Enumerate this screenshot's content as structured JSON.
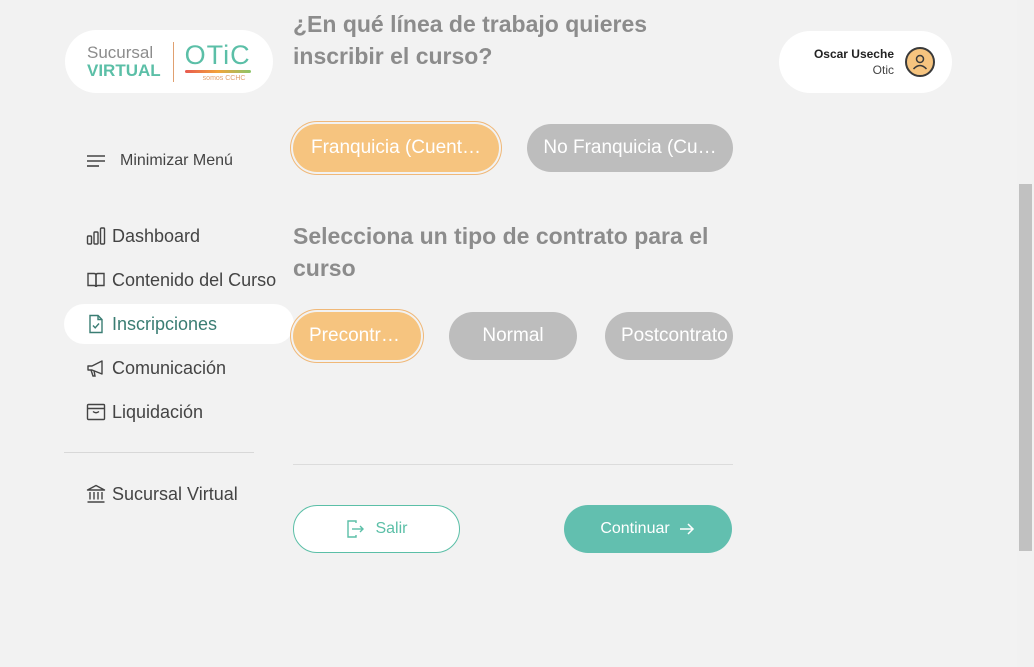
{
  "logo": {
    "line1": "Sucursal",
    "line2": "VIRTUAL",
    "brand": "OTiC",
    "brand_sub": "somos CCHC"
  },
  "sidebar": {
    "toggle_label": "Minimizar Menú",
    "items": [
      {
        "label": "Dashboard",
        "icon": "bar-chart-icon"
      },
      {
        "label": "Contenido del Curso",
        "icon": "book-icon"
      },
      {
        "label": "Inscripciones",
        "icon": "file-check-icon",
        "active": true
      },
      {
        "label": "Comunicación",
        "icon": "megaphone-icon"
      },
      {
        "label": "Liquidación",
        "icon": "archive-icon"
      }
    ],
    "footer_item": {
      "label": "Sucursal Virtual",
      "icon": "bank-icon"
    }
  },
  "main": {
    "question1": "¿En qué línea de trabajo quieres inscribir el curso?",
    "line_options": [
      "Franquicia (Cuent…",
      "No Franquicia (Cu…"
    ],
    "line_selected": "Franquicia (Cuent…",
    "question2": "Selecciona un tipo de contrato para el curso",
    "contract_options": [
      "Precontrato",
      "Normal",
      "Postcontrato"
    ],
    "contract_selected": "Precontrato",
    "exit_label": "Salir",
    "continue_label": "Continuar"
  },
  "user": {
    "name": "Oscar Useche",
    "org": "Otic"
  },
  "colors": {
    "accent_teal": "#62bfaf",
    "selected_orange": "#f6c47f",
    "chip_gray": "#bdbdbd",
    "background": "#f2f2f2"
  }
}
